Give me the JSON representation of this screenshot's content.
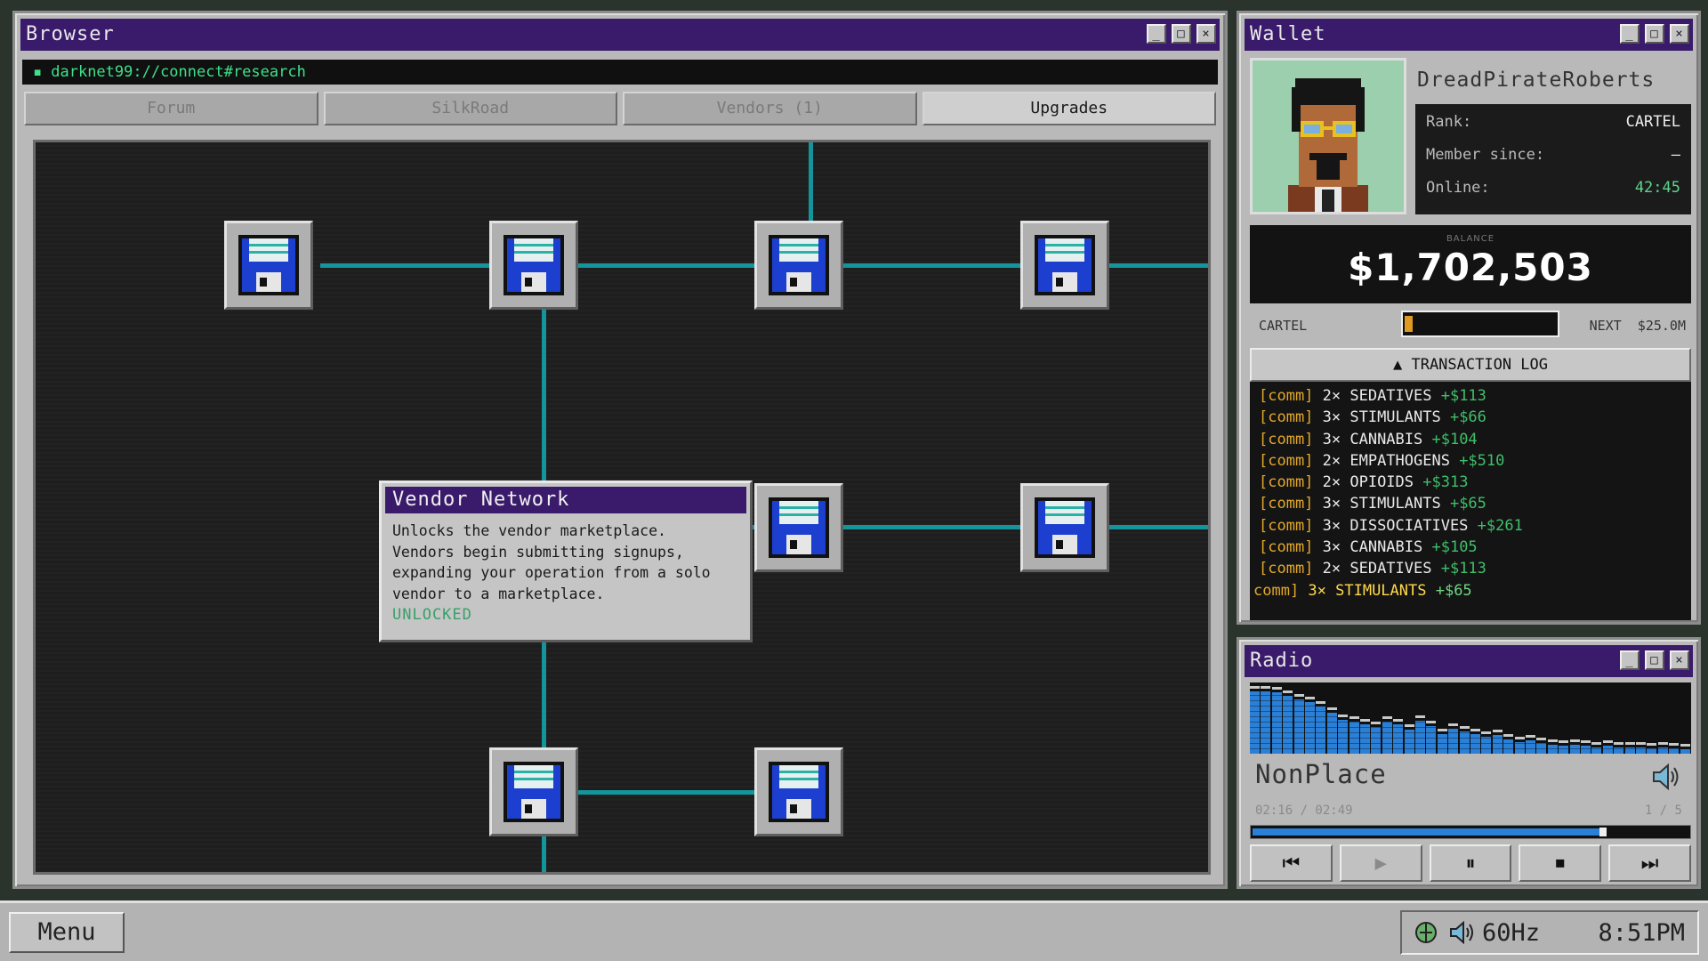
{
  "browser": {
    "title": "Browser",
    "address": "darknet99://connect#research",
    "tabs": [
      {
        "label": "Forum"
      },
      {
        "label": "SilkRoad"
      },
      {
        "label": "Vendors (1)"
      },
      {
        "label": "Upgrades"
      }
    ],
    "tooltip": {
      "title": "Vendor Network",
      "lines": [
        "Unlocks the vendor marketplace.",
        "Vendors begin submitting signups,",
        "expanding your operation from a solo",
        "vendor to a marketplace."
      ],
      "status": "UNLOCKED"
    }
  },
  "window_buttons": {
    "min": "_",
    "max": "□",
    "close": "×"
  },
  "wallet": {
    "title": "Wallet",
    "username": "DreadPirateRoberts",
    "stats": [
      {
        "label": "Rank:",
        "value": "CARTEL"
      },
      {
        "label": "Member since:",
        "value": "—"
      },
      {
        "label": "Online:",
        "value": "42:45"
      }
    ],
    "balance_label": "BALANCE",
    "balance": "$1,702,503",
    "rank_label": "CARTEL",
    "rank_progress": 0.02,
    "next_label": "NEXT  $25.0M",
    "txlog_header": "▲  TRANSACTION LOG",
    "transactions": [
      {
        "tag": "[comm]",
        "item": "2× SEDATIVES",
        "amount": "+$113"
      },
      {
        "tag": "[comm]",
        "item": "3× STIMULANTS",
        "amount": "+$66"
      },
      {
        "tag": "[comm]",
        "item": "3× CANNABIS",
        "amount": "+$104"
      },
      {
        "tag": "[comm]",
        "item": "2× EMPATHOGENS",
        "amount": "+$510"
      },
      {
        "tag": "[comm]",
        "item": "2× OPIOIDS",
        "amount": "+$313"
      },
      {
        "tag": "[comm]",
        "item": "3× STIMULANTS",
        "amount": "+$65"
      },
      {
        "tag": "[comm]",
        "item": "3× DISSOCIATIVES",
        "amount": "+$261"
      },
      {
        "tag": "[comm]",
        "item": "3× CANNABIS",
        "amount": "+$105"
      },
      {
        "tag": "[comm]",
        "item": "2× SEDATIVES",
        "amount": "+$113"
      },
      {
        "tag": "comm]",
        "item": "3× STIMULANTS",
        "amount": "+$65"
      }
    ]
  },
  "radio": {
    "title": "Radio",
    "track": "NonPlace",
    "time": "02:16 / 02:49",
    "count": "1 / 5",
    "progress": 0.8,
    "controls": [
      "⏮",
      "▶",
      "⏸",
      "⏹",
      "⏭"
    ],
    "visualizer": [
      0.95,
      0.95,
      0.93,
      0.88,
      0.83,
      0.78,
      0.72,
      0.62,
      0.52,
      0.48,
      0.45,
      0.4,
      0.48,
      0.44,
      0.36,
      0.5,
      0.42,
      0.3,
      0.38,
      0.34,
      0.3,
      0.26,
      0.28,
      0.22,
      0.18,
      0.2,
      0.16,
      0.14,
      0.12,
      0.14,
      0.12,
      0.1,
      0.12,
      0.1,
      0.1,
      0.09,
      0.08,
      0.1,
      0.08,
      0.07
    ]
  },
  "taskbar": {
    "menu": "Menu",
    "refresh": "60Hz",
    "clock": "8:51PM"
  },
  "colors": {
    "titlebar": "#3a1a6a",
    "link": "#13959b",
    "accent_green": "#3fbf6a",
    "accent_orange": "#e3a82a",
    "radio_blue": "#2a7fd6"
  }
}
